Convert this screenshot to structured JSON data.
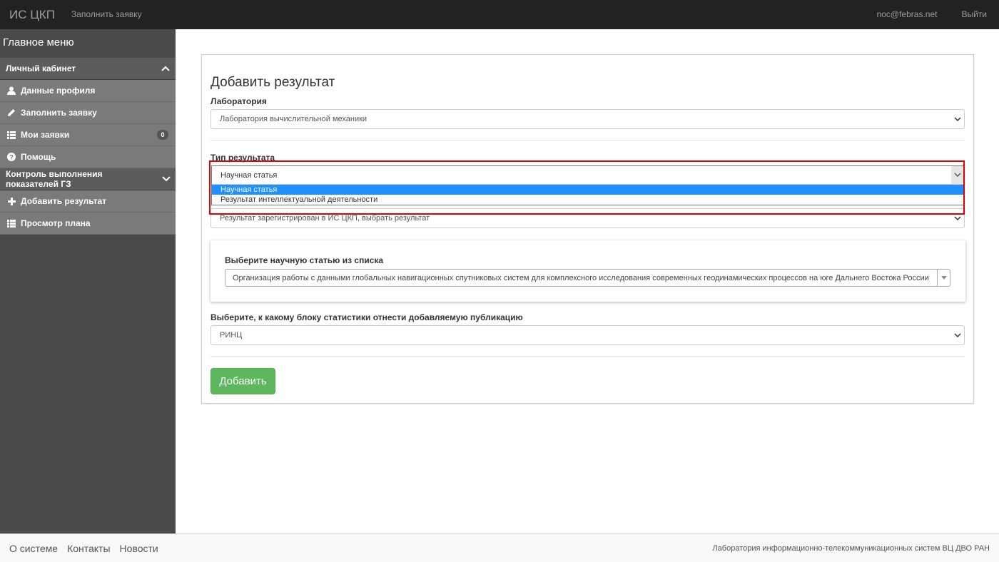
{
  "navbar": {
    "brand": "ИС ЦКП",
    "fill_request": "Заполнить заявку",
    "user_email": "noc@febras.net",
    "logout": "Выйти"
  },
  "sidebar": {
    "title": "Главное меню",
    "sections": [
      {
        "label": "Личный кабинет",
        "items": [
          {
            "label": "Данные профиля",
            "icon": "user-icon"
          },
          {
            "label": "Заполнить заявку",
            "icon": "pencil-icon"
          },
          {
            "label": "Мои заявки",
            "icon": "list-icon",
            "badge": "0"
          },
          {
            "label": "Помощь",
            "icon": "question-icon"
          }
        ]
      },
      {
        "label": "Контроль выполнения показателей ГЗ",
        "items": [
          {
            "label": "Добавить результат",
            "icon": "plus-icon"
          },
          {
            "label": "Просмотр плана",
            "icon": "list-icon"
          }
        ]
      }
    ]
  },
  "form": {
    "title": "Добавить результат",
    "lab_label": "Лаборатория",
    "lab_value": "Лаборатория вычислительной механики",
    "type_label": "Тип результата",
    "type_value": "Научная статья",
    "type_options": [
      "Научная статья",
      "Результат интеллектуальной деятельности"
    ],
    "source_value": "Результат зарегистрирован в ИС ЦКП, выбрать результат",
    "article_label": "Выберите научную статью из списка",
    "article_value": "Организация работы с данными глобальных навигационных спутниковых систем для комплексного исследования современных геодинамических процессов на юге Дальнего Востока России",
    "stat_label": "Выберите, к какому блоку статистики отнести добавляемую публикацию",
    "stat_value": "РИНЦ",
    "submit": "Добавить"
  },
  "footer": {
    "links": [
      "О системе",
      "Контакты",
      "Новости"
    ],
    "org": "Лаборатория информационно-телекоммуникационных систем ВЦ ДВО РАН"
  },
  "colors": {
    "navbar_bg": "#222222",
    "sidebar_bg": "#4a4a4a",
    "submit_green": "#5cb85c",
    "highlight_red": "#e00000",
    "option_selected": "#1e90ff"
  }
}
